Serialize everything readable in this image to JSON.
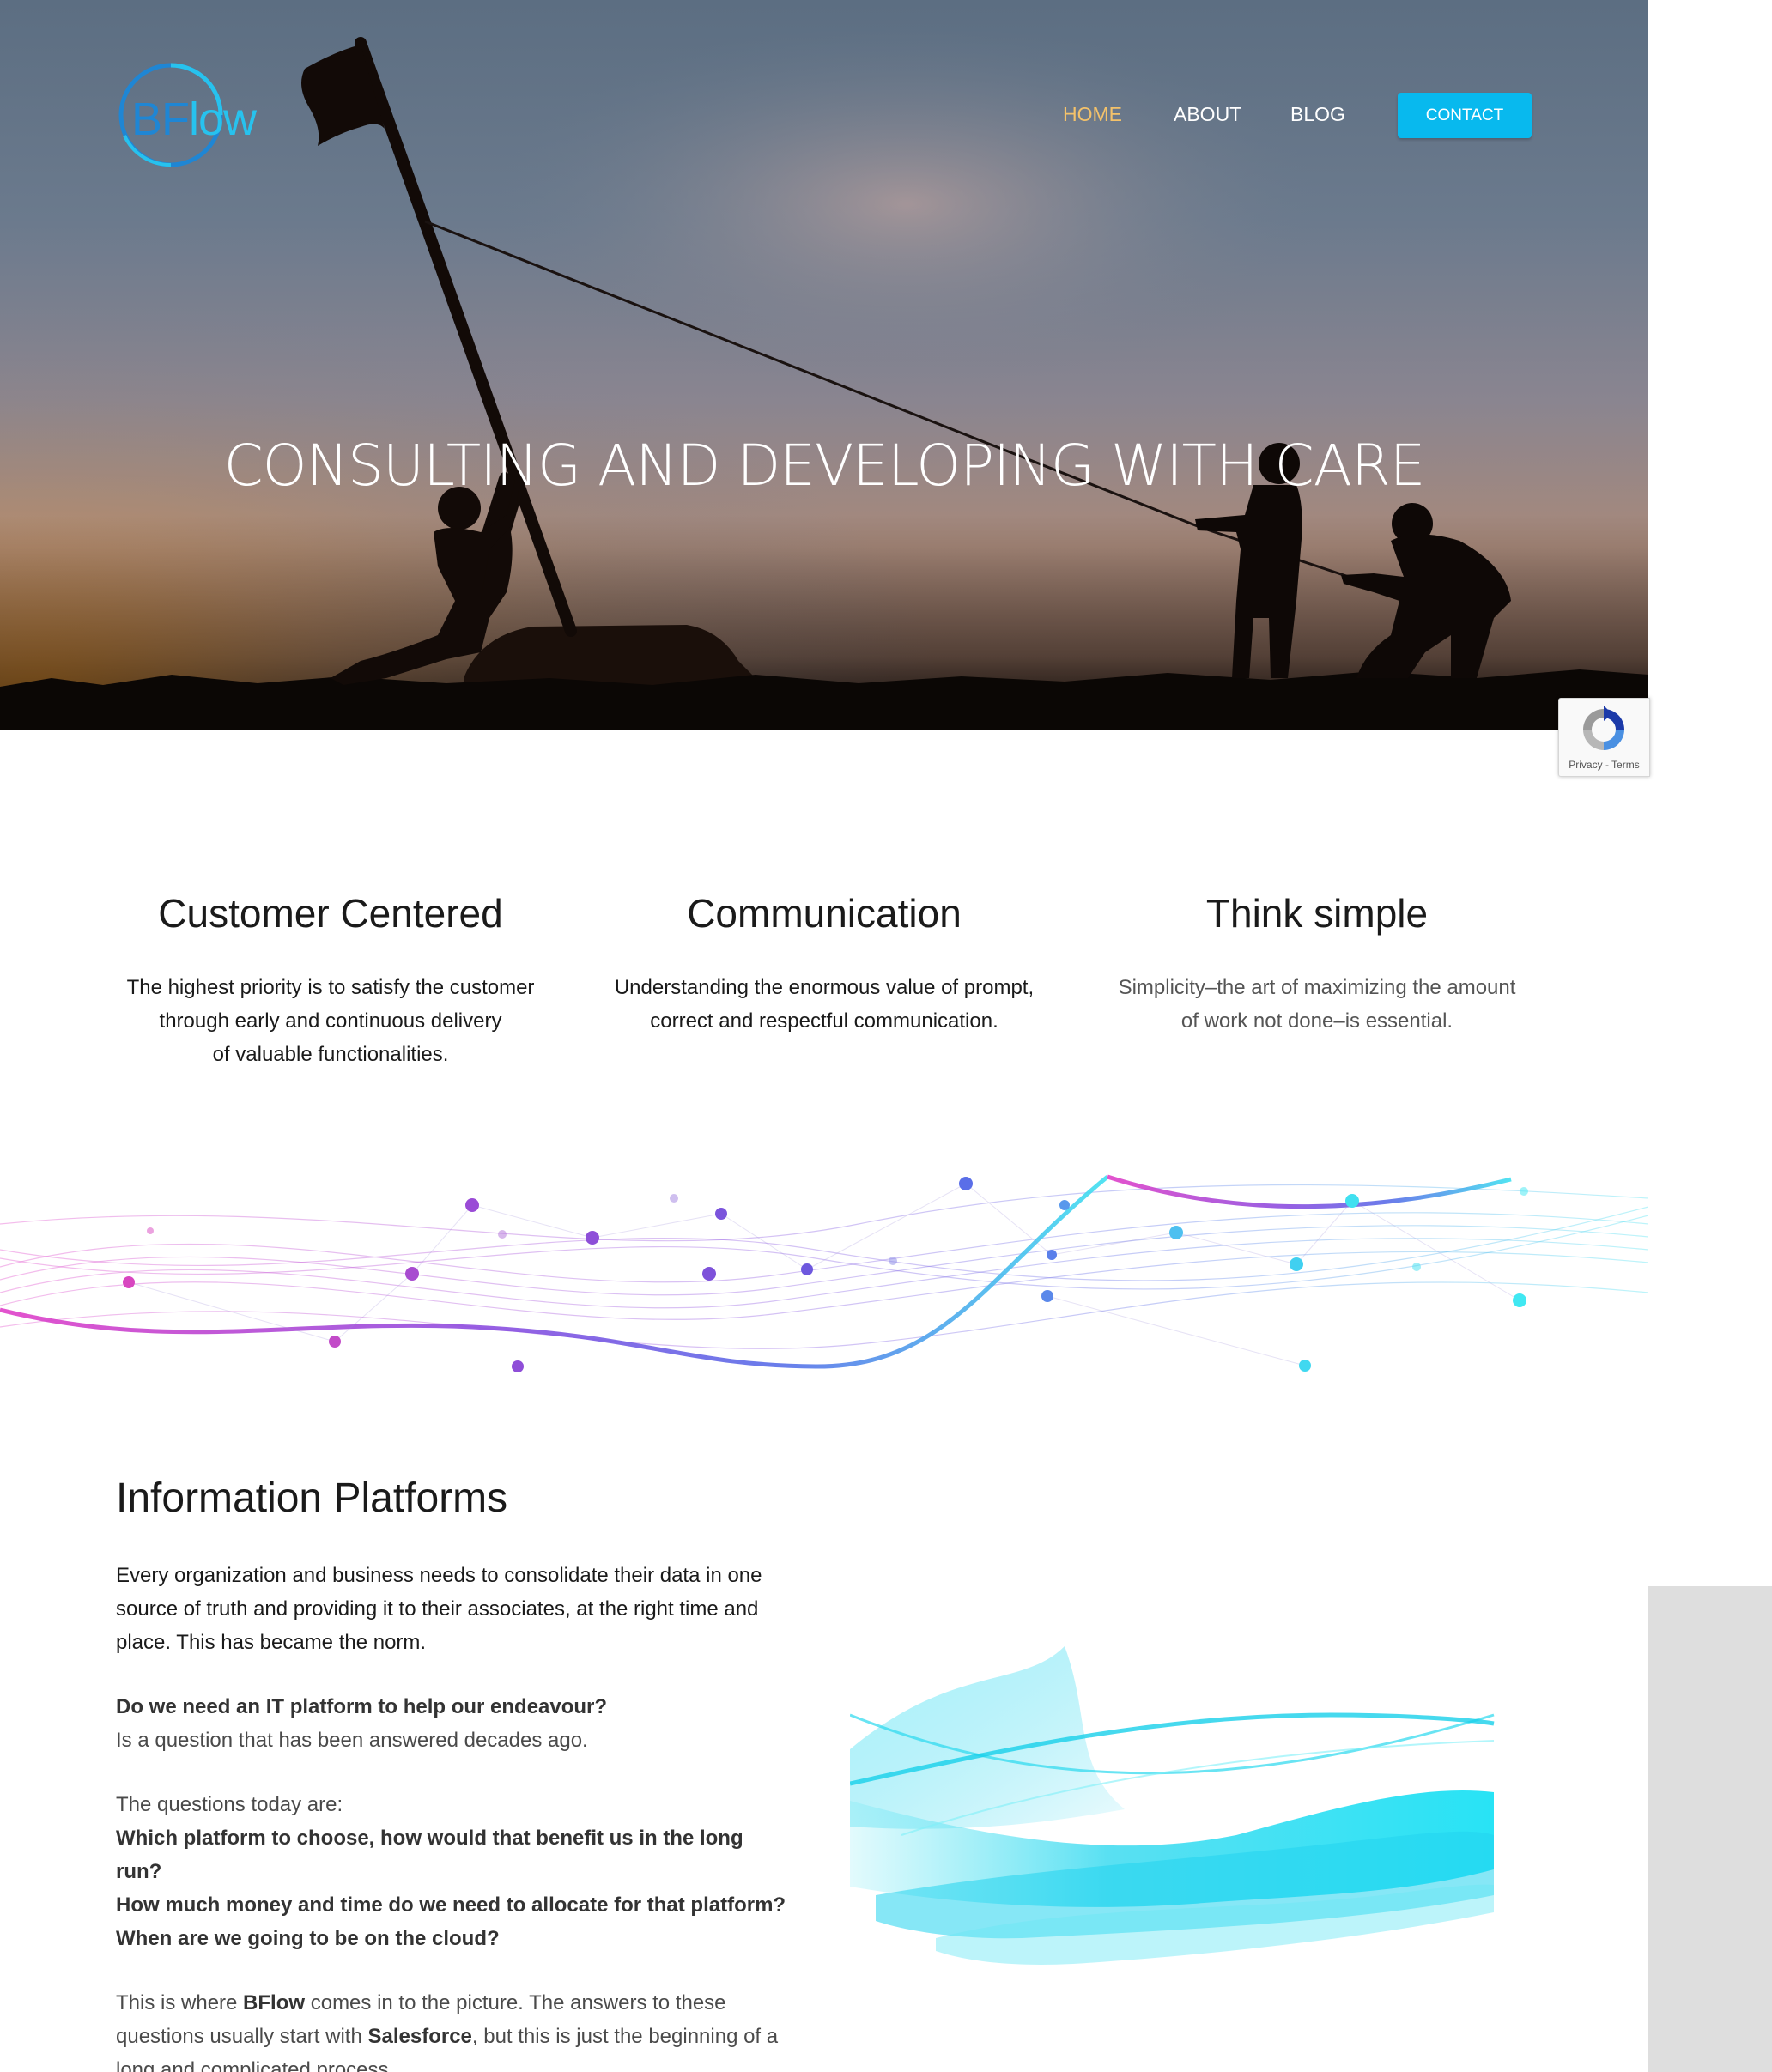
{
  "logo": {
    "text_b": "BF",
    "text_low": "low"
  },
  "nav": {
    "items": [
      {
        "label": "HOME",
        "active": true
      },
      {
        "label": "ABOUT",
        "active": false
      },
      {
        "label": "BLOG",
        "active": false
      }
    ],
    "contact_label": "CONTACT"
  },
  "hero": {
    "title": "CONSULTING AND DEVELOPING WITH CARE"
  },
  "recaptcha": {
    "terms": "Privacy - Terms"
  },
  "values": [
    {
      "title": "Customer Centered",
      "text": "The highest priority is to satisfy the customer\nthrough early and continuous delivery\nof valuable functionalities."
    },
    {
      "title": "Communication",
      "text": "Understanding the enormous value of prompt,\ncorrect and respectful communication."
    },
    {
      "title": "Think simple",
      "text": "Simplicity–the art of maximizing the amount\nof work not done–is essential."
    }
  ],
  "info": {
    "title": "Information Platforms",
    "p1": "Every organization and business needs to consolidate their data in one source of truth and providing it to their associates, at the right time and place. This has became the norm.",
    "q1": "Do we need an IT platform to help our endeavour?",
    "a1": "Is a question that has been answered decades ago.",
    "intro_q": "The questions today are:",
    "q2": "Which platform to choose, how would that benefit us in the long run?",
    "q3": "How much money and time do we need to allocate for that platform?",
    "q4": "When are we going to be on the cloud?",
    "p_last_1": "This is where ",
    "brand": "BFlow",
    "p_last_2": " comes in to the picture. The answers to these questions usually start with ",
    "platform": "Salesforce",
    "p_last_3": ", but this is just the beginning of a long and complicated process."
  },
  "colors": {
    "accent_nav_active": "#f4c26a",
    "contact_button": "#08b9ee",
    "logo_blue": "#1f86d4",
    "logo_cyan": "#27c2ee",
    "wave_magenta": "#e040c8",
    "wave_violet": "#7a4fe0",
    "wave_cyan": "#40e0f0"
  },
  "icons": {
    "logo": "bflow-logo",
    "recaptcha": "recaptcha-icon"
  }
}
